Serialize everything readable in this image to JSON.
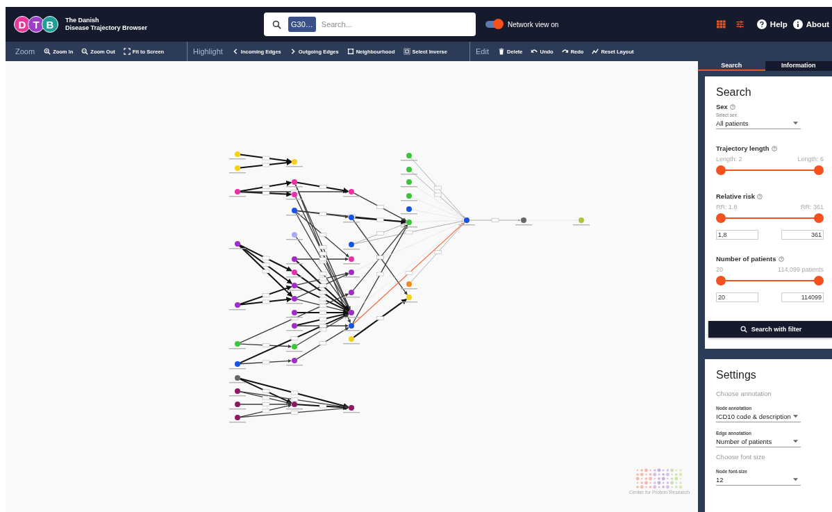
{
  "header": {
    "logo_letters": [
      {
        "letter": "D",
        "color": "#e6399b"
      },
      {
        "letter": "T",
        "color": "#9b3fc7"
      },
      {
        "letter": "B",
        "color": "#1f9e9a"
      }
    ],
    "title_lines": [
      "The Danish",
      "Disease Trajectory Browser"
    ],
    "search": {
      "chip": "G30…",
      "placeholder": "Search..."
    },
    "network_toggle": {
      "label": "Network view on",
      "on": true
    },
    "links": [
      {
        "label": "Help",
        "kind": "help"
      },
      {
        "label": "About",
        "kind": "about"
      }
    ]
  },
  "toolbar": [
    {
      "title": "Zoom",
      "items": [
        {
          "label": "Zoom In",
          "kind": "zoom-in"
        },
        {
          "label": "Zoom Out",
          "kind": "zoom-out"
        },
        {
          "label": "Fit to Screen",
          "kind": "fit"
        }
      ]
    },
    {
      "title": "Highlight",
      "items": [
        {
          "label": "Incoming Edges",
          "kind": "chevron-left"
        },
        {
          "label": "Outgoing Edges",
          "kind": "chevron-right"
        },
        {
          "label": "Neighbourhood",
          "kind": "neighbourhood"
        },
        {
          "label": "Select Inverse",
          "kind": "select-inverse"
        }
      ]
    },
    {
      "title": "Edit",
      "items": [
        {
          "label": "Delete",
          "kind": "trash"
        },
        {
          "label": "Undo",
          "kind": "undo"
        },
        {
          "label": "Redo",
          "kind": "redo"
        },
        {
          "label": "Reset Layout",
          "kind": "reset"
        }
      ]
    }
  ],
  "graph_logo": {
    "caption": "Center for Protein Research"
  },
  "tabs": [
    {
      "label": "Search",
      "selected": true
    },
    {
      "label": "Information",
      "selected": false
    }
  ],
  "search_panel": {
    "title": "Search",
    "sex": {
      "label": "Sex",
      "hint": "Select sex",
      "value": "All patients"
    },
    "ranges": [
      {
        "label": "Trajectory length",
        "min_label": "Length: 2",
        "max_label": "Length: 6",
        "level": 1
      },
      {
        "label": "Relative risk",
        "min_label": "RR: 1.8",
        "max_label": "RR: 361",
        "level": 1,
        "min_input": "1,8",
        "max_input": "361"
      },
      {
        "label": "Number of patients",
        "min_label": "20",
        "max_label": "114,099 patients",
        "level": 1,
        "min_input": "20",
        "max_input": "114099"
      }
    ],
    "button": "Search with filter"
  },
  "settings_panel": {
    "title": "Settings",
    "sections": [
      {
        "subtitle": "Choose annotation",
        "selects": [
          {
            "label": "Node annotation",
            "value": "ICD10 code & description"
          },
          {
            "label": "Edge annotation",
            "value": "Number of patients"
          }
        ]
      },
      {
        "subtitle": "Choose font size",
        "selects": [
          {
            "label": "Node font-size",
            "value": "12"
          }
        ]
      }
    ]
  }
}
